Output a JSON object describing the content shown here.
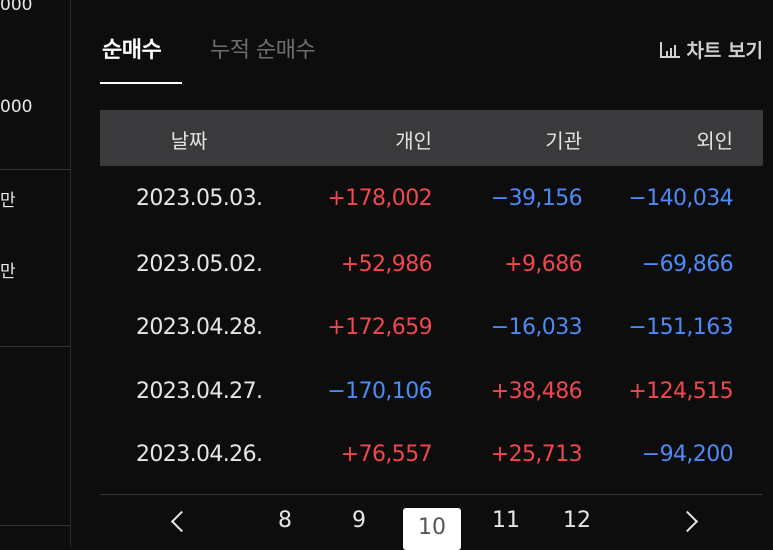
{
  "left_column": {
    "values": [
      "000",
      "000",
      "만",
      "만"
    ]
  },
  "tabs": [
    {
      "label": "순매수",
      "active": true
    },
    {
      "label": "누적 순매수",
      "active": false
    }
  ],
  "chart_button": {
    "label": "차트 보기",
    "icon": "bar-chart-icon"
  },
  "table": {
    "columns": [
      "날짜",
      "개인",
      "기관",
      "외인"
    ],
    "rows": [
      {
        "date": "2023.05.03.",
        "individual": "+178,002",
        "institution": "−39,156",
        "foreign": "−140,034"
      },
      {
        "date": "2023.05.02.",
        "individual": "+52,986",
        "institution": "+9,686",
        "foreign": "−69,866"
      },
      {
        "date": "2023.04.28.",
        "individual": "+172,659",
        "institution": "−16,033",
        "foreign": "−151,163"
      },
      {
        "date": "2023.04.27.",
        "individual": "−170,106",
        "institution": "+38,486",
        "foreign": "+124,515"
      },
      {
        "date": "2023.04.26.",
        "individual": "+76,557",
        "institution": "+25,713",
        "foreign": "−94,200"
      }
    ]
  },
  "pagination": {
    "pages": [
      "8",
      "9",
      "10",
      "11",
      "12"
    ],
    "current": "10"
  },
  "colors": {
    "positive": "#f0484c",
    "negative": "#4e8af5",
    "background": "#0d0d0e",
    "header": "#3a3a3d"
  }
}
